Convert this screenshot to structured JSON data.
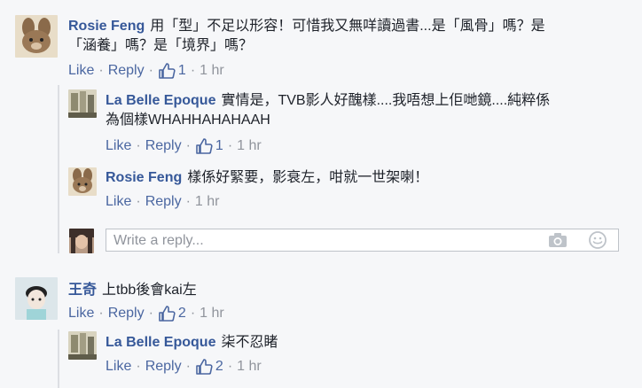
{
  "comments": [
    {
      "author": "Rosie Feng",
      "body_line1": "用「型」不足以形容！可惜我又無咩讀過書...是「風骨」嗎？是",
      "body_line2": "「涵養」嗎？是「境界」嗎？",
      "like": "Like",
      "reply": "Reply",
      "likes": "1",
      "time": "1 hr",
      "replies": [
        {
          "author": "La Belle Epoque",
          "body_line1": "實情是，TVB影人好醜樣....我唔想上佢哋鏡....純粹係",
          "body_line2": "為個樣WHAHHAHAHAAH",
          "like": "Like",
          "reply": "Reply",
          "likes": "1",
          "time": "1 hr"
        },
        {
          "author": "Rosie Feng",
          "body_line1": "樣係好緊要，影衰左，咁就一世架喇！",
          "like": "Like",
          "reply": "Reply",
          "time": "1 hr"
        }
      ]
    },
    {
      "author": "王奇",
      "body_line1": "上tbb後會kai左",
      "like": "Like",
      "reply": "Reply",
      "likes": "2",
      "time": "1 hr",
      "replies": [
        {
          "author": "La Belle Epoque",
          "body_line1": "柒不忍睹",
          "like": "Like",
          "reply": "Reply",
          "likes": "2",
          "time": "1 hr"
        }
      ]
    }
  ],
  "reply_box": {
    "placeholder": "Write a reply..."
  },
  "icons": [
    "camera-icon",
    "emoji-icon",
    "thumbs-up-icon"
  ],
  "colors": {
    "name": "#365899",
    "link": "#4b67a1",
    "meta": "#90949c",
    "background": "#f6f7f9"
  }
}
